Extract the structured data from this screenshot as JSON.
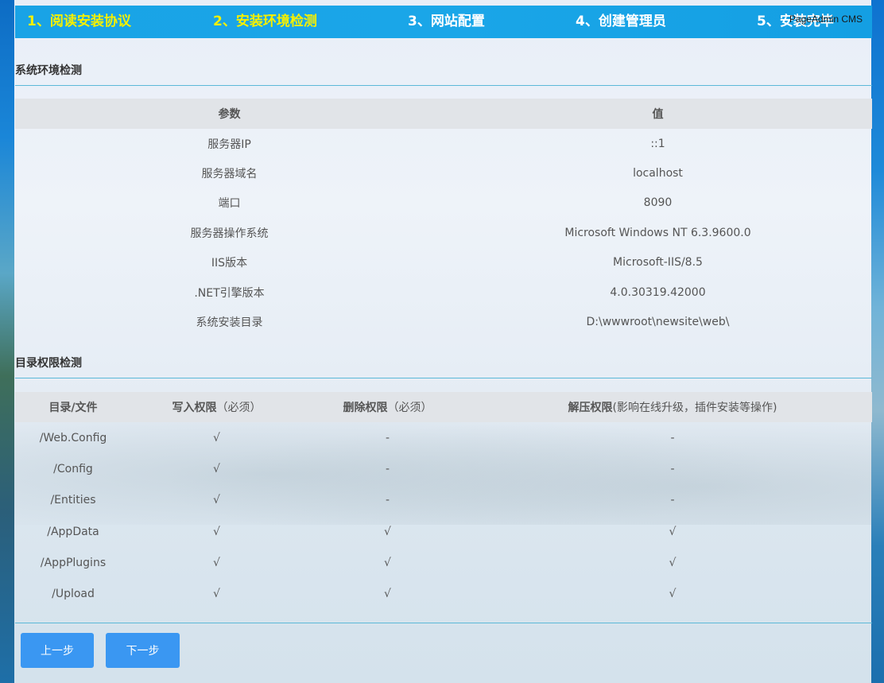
{
  "brand": "PageAdmin CMS",
  "steps": [
    {
      "label": "1、阅读安装协议",
      "done": true
    },
    {
      "label": "2、安装环境检测",
      "done": true
    },
    {
      "label": "3、网站配置",
      "done": false
    },
    {
      "label": "4、创建管理员",
      "done": false
    },
    {
      "label": "5、安装完毕",
      "done": false
    }
  ],
  "env_section": {
    "title": "系统环境检测",
    "headers": [
      "参数",
      "值"
    ],
    "rows": [
      {
        "param": "服务器IP",
        "value": "::1"
      },
      {
        "param": "服务器域名",
        "value": "localhost"
      },
      {
        "param": "端口",
        "value": "8090"
      },
      {
        "param": "服务器操作系统",
        "value": "Microsoft Windows NT 6.3.9600.0"
      },
      {
        "param": "IIS版本",
        "value": "Microsoft-IIS/8.5"
      },
      {
        "param": ".NET引擎版本",
        "value": "4.0.30319.42000"
      },
      {
        "param": "系统安装目录",
        "value": "D:\\wwwroot\\newsite\\web\\"
      }
    ]
  },
  "dir_section": {
    "title": "目录权限检测",
    "headers": {
      "path": "目录/文件",
      "write": "写入权限",
      "write_note": "（必须）",
      "delete": "删除权限",
      "delete_note": "（必须）",
      "unzip": "解压权限",
      "unzip_note": "(影响在线升级，插件安装等操作)"
    },
    "rows": [
      {
        "path": "/Web.Config",
        "write": "√",
        "delete": "-",
        "unzip": "-"
      },
      {
        "path": "/Config",
        "write": "√",
        "delete": "-",
        "unzip": "-"
      },
      {
        "path": "/Entities",
        "write": "√",
        "delete": "-",
        "unzip": "-"
      },
      {
        "path": "/AppData",
        "write": "√",
        "delete": "√",
        "unzip": "√"
      },
      {
        "path": "/AppPlugins",
        "write": "√",
        "delete": "√",
        "unzip": "√"
      },
      {
        "path": "/Upload",
        "write": "√",
        "delete": "√",
        "unzip": "√"
      }
    ]
  },
  "buttons": {
    "prev": "上一步",
    "next": "下一步"
  },
  "colors": {
    "step_bar": "#19a3e6",
    "step_done": "#f5f000",
    "step_todo": "#ffffff",
    "rule": "#5cb8d8",
    "table_header": "#e1e4e8",
    "button": "#3a97f2"
  }
}
